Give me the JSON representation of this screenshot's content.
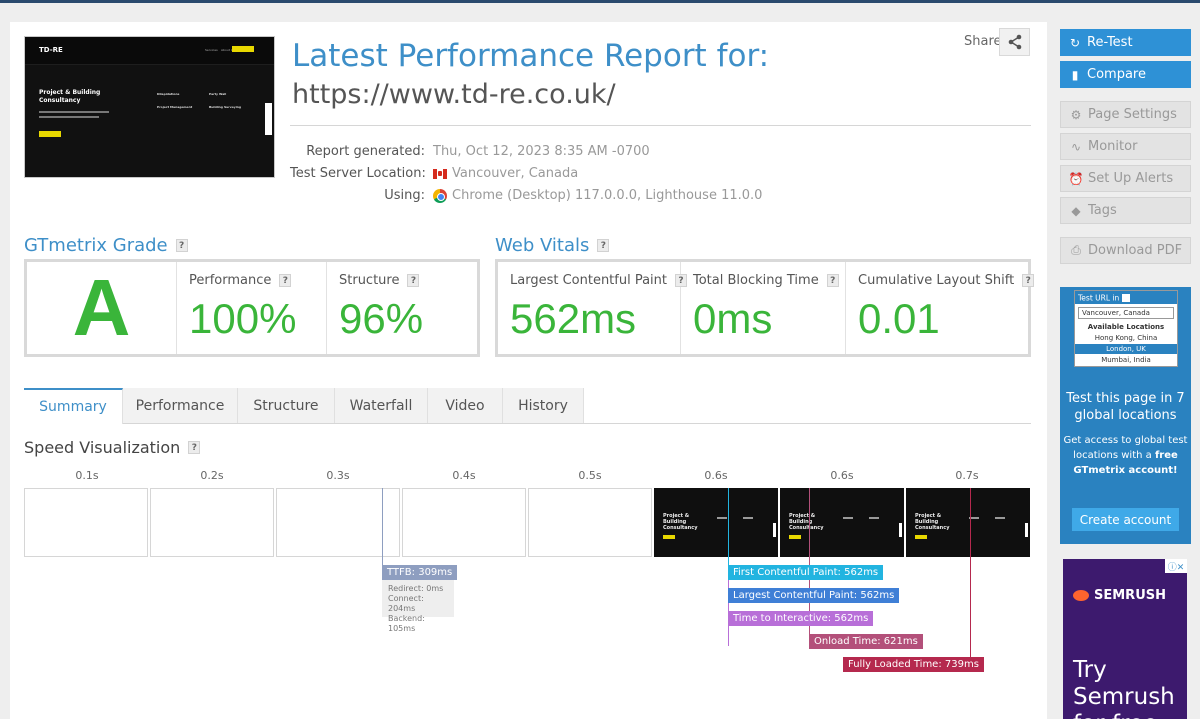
{
  "report": {
    "title": "Latest Performance Report for:",
    "url": "https://www.td-re.co.uk/",
    "share_label": "Share",
    "meta": {
      "generated_label": "Report generated:",
      "generated_value": "Thu, Oct 12, 2023 8:35 AM -0700",
      "server_label": "Test Server Location:",
      "server_value": "Vancouver, Canada",
      "using_label": "Using:",
      "using_value": "Chrome (Desktop) 117.0.0.0, Lighthouse 11.0.0"
    }
  },
  "thumbnail": {
    "logo": "TD-RE",
    "nav": [
      "Services",
      "About Us",
      "Contact"
    ],
    "heading": "Project & Building Consultancy",
    "cols": [
      "Dilapidations",
      "Party Wall",
      "Project Management",
      "Building Surveying"
    ]
  },
  "grade": {
    "title": "GTmetrix Grade",
    "letter": "A",
    "performance_label": "Performance",
    "performance_value": "100%",
    "structure_label": "Structure",
    "structure_value": "96%"
  },
  "vitals": {
    "title": "Web Vitals",
    "lcp_label": "Largest Contentful Paint",
    "lcp_value": "562ms",
    "tbt_label": "Total Blocking Time",
    "tbt_value": "0ms",
    "cls_label": "Cumulative Layout Shift",
    "cls_value": "0.01"
  },
  "help_glyph": "?",
  "tabs": [
    "Summary",
    "Performance",
    "Structure",
    "Waterfall",
    "Video",
    "History"
  ],
  "speed": {
    "title": "Speed Visualization",
    "times": [
      "0.1s",
      "0.2s",
      "0.3s",
      "0.4s",
      "0.5s",
      "0.6s",
      "0.6s",
      "0.7s"
    ],
    "frame_heading": "Project & Building Consultancy",
    "markers": {
      "ttfb": "TTFB: 309ms",
      "fcp": "First Contentful Paint: 562ms",
      "lcp": "Largest Contentful Paint: 562ms",
      "tti": "Time to Interactive: 562ms",
      "onload": "Onload Time: 621ms",
      "fully": "Fully Loaded Time: 739ms"
    },
    "ttfb_detail": [
      "Redirect: 0ms",
      "Connect: 204ms",
      "Backend: 105ms"
    ],
    "colors": {
      "ttfb": "#8e9ec0",
      "fcp": "#22b4e0",
      "lcp": "#3f7fd6",
      "tti": "#b86fd8",
      "onload": "#b3507a",
      "fully": "#b5294e"
    }
  },
  "sidebar": {
    "retest": "Re-Test",
    "compare": "Compare",
    "page_settings": "Page Settings",
    "monitor": "Monitor",
    "alerts": "Set Up Alerts",
    "tags": "Tags",
    "download_pdf": "Download PDF",
    "promo": {
      "mini_header": "Test URL in",
      "mini_input": "Vancouver, Canada",
      "mini_heading": "Available Locations",
      "mini_locations": [
        "Hong Kong, China",
        "London, UK",
        "Mumbai, India"
      ],
      "headline": "Test this page in 7 global locations",
      "body_prefix": "Get access to global test locations with a",
      "body_bold": "free GTmetrix account!",
      "cta": "Create account"
    },
    "ad": {
      "brand": "SEMRUSH",
      "text": "Try Semrush for free"
    }
  }
}
